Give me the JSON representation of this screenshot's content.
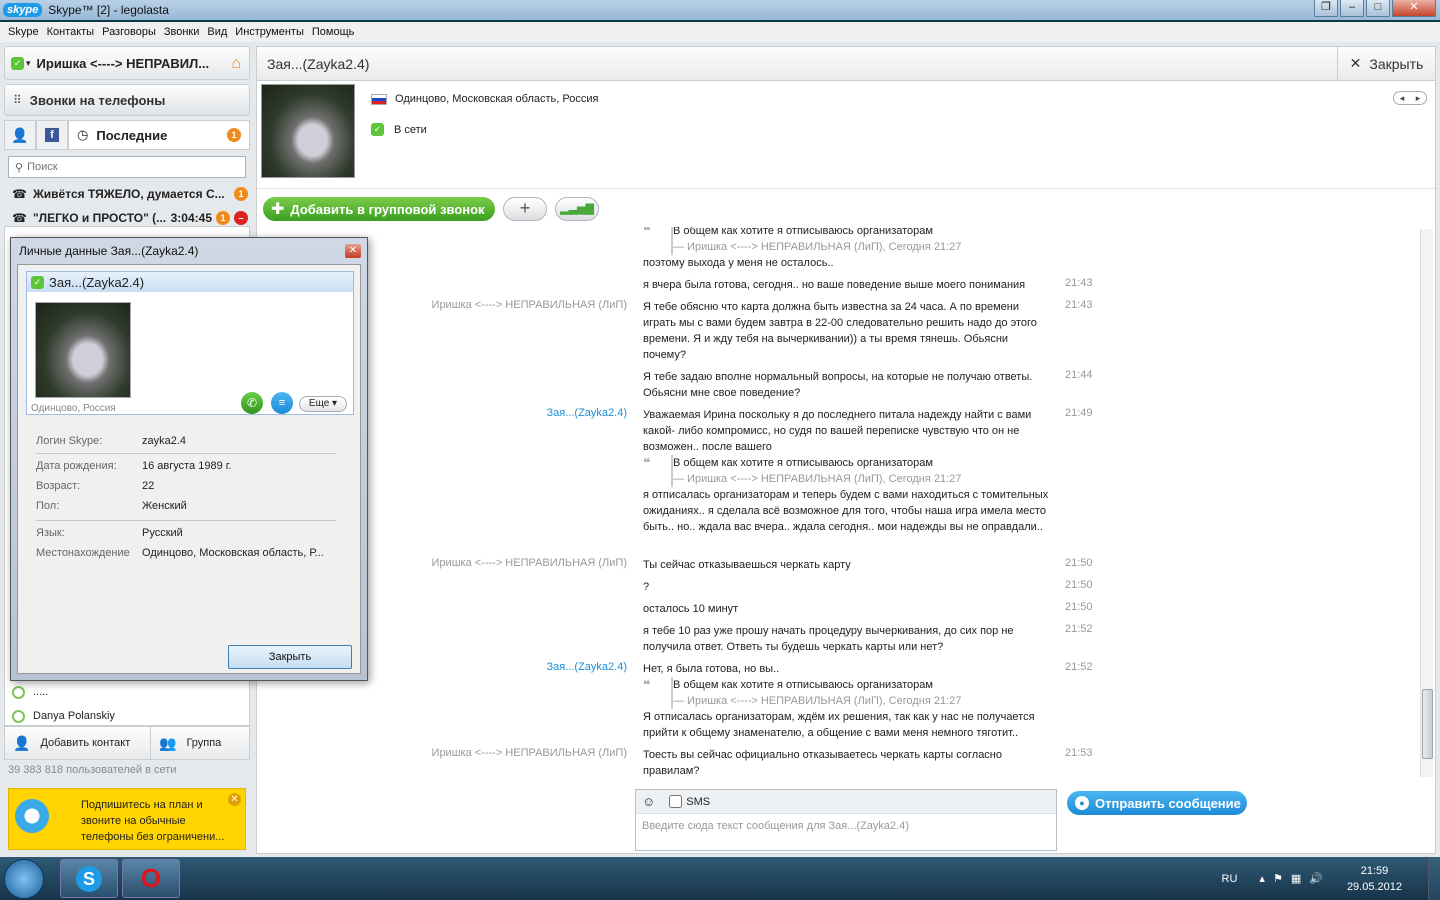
{
  "window": {
    "logo": "skype",
    "title": "Skype™ [2] - legolasta",
    "buttons": [
      "restore-icon",
      "minimize-icon",
      "maximize-icon",
      "close-icon"
    ]
  },
  "menu": [
    "Skype",
    "Контакты",
    "Разговоры",
    "Звонки",
    "Вид",
    "Инструменты",
    "Помощь"
  ],
  "sidebar": {
    "user_name": "Иришка <----> НЕПРАВИЛ...",
    "calls_label": "Звонки на телефоны",
    "recent_tab": "Последние",
    "recent_badge": "1",
    "search_placeholder": "Поиск",
    "conversations": [
      {
        "label": "Живётся ТЯЖЕЛО, думается С...",
        "badge": "1"
      },
      {
        "label": "\"ЛЕГКО и ПРОСТО\" (...",
        "time": "3:04:45",
        "badge": "1"
      }
    ],
    "contacts": [
      {
        "label": "....."
      },
      {
        "label": "Danya Polanskiy"
      }
    ],
    "add_contact": "Добавить контакт",
    "group": "Группа",
    "online_count": "39 383 818 пользователей в сети",
    "promo_text": "Подпишитесь на план и звоните на обычные телефоны без ограничени..."
  },
  "chat": {
    "title": "Зая...(Zayka2.4)",
    "close_label": "Закрыть",
    "location": "Одинцово, Московская область, Россия",
    "status": "В сети",
    "add_group_call": "Добавить в групповой звонок",
    "plus": "+",
    "send_label": "Отправить сообщение",
    "sms_label": "SMS",
    "input_placeholder": "Введите сюда текст сообщения для Зая...(Zayka2.4)",
    "messages": [
      {
        "sender": "",
        "text": "поэтому выхода у меня не осталось..",
        "time": ""
      },
      {
        "sender": "",
        "text": "я вчера была готова, сегодня.. но ваше поведение выше моего понимания",
        "time": "21:43"
      },
      {
        "sender": "Иришка <----> НЕПРАВИЛЬНАЯ (ЛиП)",
        "text": "Я тебе обясню что карта должна быть известна за 24 часа. А по времени играть мы с вами будем завтра в 22-00 следовательно решить надо до этого времени. Я и жду тебя на вычеркивании)) а ты время тянешь. Обьясни почему?",
        "time": "21:43"
      },
      {
        "sender": "",
        "text": "Я тебе задаю вполне нормальный вопросы, на которые не получаю ответы. Обьясни мне свое поведение?",
        "time": "21:44"
      },
      {
        "sender": "Зая...(Zayka2.4)",
        "text": "Уважаемая Ирина поскольку я до последнего питала надежду найти с вами какой- либо компромисс, но судя по вашей переписке чувствую что он не возможен.. после вашего",
        "time": "21:49"
      },
      {
        "sender": "",
        "text": "я отписалась организаторам и теперь будем с вами находиться с томительных ожиданиях.. я сделала всё возможное для того, чтобы наша игра имела место быть.. но.. ждала вас вчера.. ждала сегодня.. мои надежды вы не оправдали..",
        "time": ""
      },
      {
        "sender": "Иришка <----> НЕПРАВИЛЬНАЯ (ЛиП)",
        "text": "Ты сейчас отказываешься черкать карту",
        "time": "21:50"
      },
      {
        "sender": "",
        "text": "?",
        "time": "21:50"
      },
      {
        "sender": "",
        "text": "осталось 10 минут",
        "time": "21:50"
      },
      {
        "sender": "",
        "text": "я тебе 10 раз уже прошу начать процедуру вычеркивания, до сих пор не получила ответ. Ответь ты будешь черкать карты или нет?",
        "time": "21:52"
      },
      {
        "sender": "Зая...(Zayka2.4)",
        "text": "Нет, я была готова, но вы..",
        "time": "21:52"
      },
      {
        "sender": "",
        "text": "Я отписалась организаторам, ждём их решения, так как у нас не получается прийти к общему знаменателю, а общение с вами меня немного тяготит..",
        "time": ""
      },
      {
        "sender": "Иришка <----> НЕПРАВИЛЬНАЯ (ЛиП)",
        "text": "Тоесть вы сейчас официально отказываетесь черкать карты согласно правилам?",
        "time": "21:53"
      }
    ],
    "quote": {
      "text": "В общем как хотите я отписываюсь организаторам",
      "meta": "— Иришка <----> НЕПРАВИЛЬНАЯ (ЛиП), Сегодня 21:27"
    }
  },
  "dialog": {
    "title": "Личные данные Зая...(Zayka2.4)",
    "name": "Зая...(Zayka2.4)",
    "card_location": "Одинцово, Россия",
    "more_label": "Еще",
    "fields": [
      {
        "k": "Логин Skype:",
        "v": "zayka2.4"
      },
      {
        "k": "Дата рождения:",
        "v": "16 августа 1989 г."
      },
      {
        "k": "Возраст:",
        "v": "22"
      },
      {
        "k": "Пол:",
        "v": "Женский"
      },
      {
        "k": "Язык:",
        "v": "Русский"
      },
      {
        "k": "Местонахождение",
        "v": "Одинцово, Московская область, Р..."
      }
    ],
    "close_label": "Закрыть"
  },
  "taskbar": {
    "lang": "RU",
    "time": "21:59",
    "date": "29.05.2012"
  }
}
